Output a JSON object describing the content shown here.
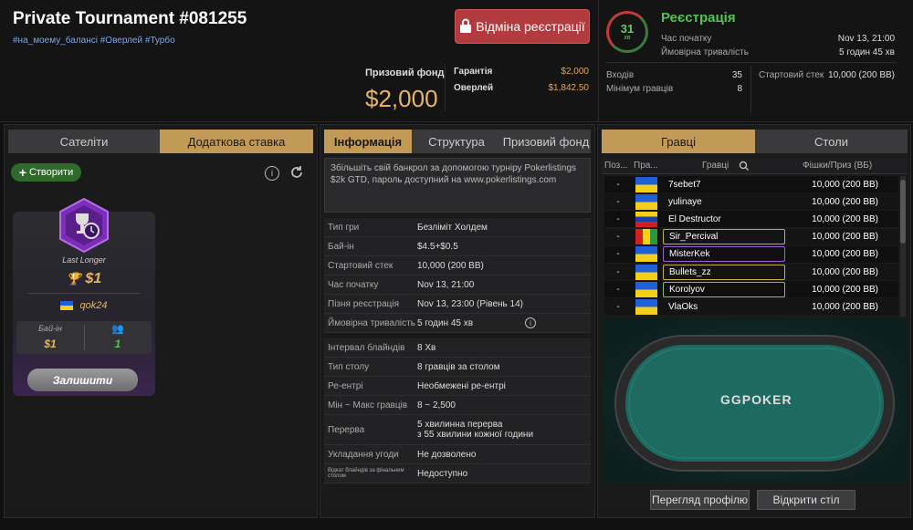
{
  "header": {
    "title": "Private Tournament #081255",
    "tags": "#на_моему_балансі #Оверлей #Турбо",
    "cancel_button": "Відміна реєстрації",
    "prize_fund_label": "Призовий фонд",
    "prize_fund_value": "$2,000",
    "guarantee_label": "Гарантія",
    "guarantee_value": "$2,000",
    "overlay_label": "Оверлей",
    "overlay_value": "$1,842.50",
    "timer_value": "31",
    "timer_unit": "хв",
    "reg_status": "Реєстрація",
    "start_time_label": "Час початку",
    "start_time_value": "Nov 13, 21:00",
    "duration_label": "Ймовірна тривалість",
    "duration_value": "5 годин 45 хв",
    "entries_label": "Входів",
    "entries_value": "35",
    "min_players_label": "Мінімум гравців",
    "min_players_value": "8",
    "start_stack_label": "Стартовий стек",
    "start_stack_value": "10,000 (200 BB)"
  },
  "left": {
    "tabs": [
      "Сателіти",
      "Додаткова ставка"
    ],
    "create_button": "Створити",
    "card": {
      "label": "Last Longer",
      "value": "$1",
      "owner": "qok24",
      "buyin_label": "Бай-ін",
      "buyin_value": "$1",
      "players_value": "1"
    },
    "stay_button": "Залишити"
  },
  "middle": {
    "tabs": [
      "Інформація",
      "Структура",
      "Призовий фонд"
    ],
    "description": "Збільшіть свій банкрол за допомогою турніру Pokerlistings $2k GTD, пароль доступний на www.pokerlistings.com",
    "rows": [
      {
        "k": "Тип гри",
        "v": "Безліміт Холдем"
      },
      {
        "k": "Бай-ін",
        "v": "$4.5+$0.5"
      },
      {
        "k": "Стартовий стек",
        "v": "10,000 (200 BB)"
      },
      {
        "k": "Час початку",
        "v": "Nov 13, 21:00"
      },
      {
        "k": "Пізня реєстрація",
        "v": "Nov 13, 23:00 (Рівень 14)"
      },
      {
        "k": "Ймовірна тривалість",
        "v": "5 годин 45 хв"
      },
      {
        "k": "Інтервал блайндів",
        "v": "8 Хв"
      },
      {
        "k": "Тип столу",
        "v": "8 гравців за столом"
      },
      {
        "k": "Ре-ентрі",
        "v": "Необмежені ре-ентрі"
      },
      {
        "k": "Мін ~ Макс гравців",
        "v": "8 ~ 2,500"
      },
      {
        "k": "Перерва",
        "v": "5 хвилинна перерва\nз 55 хвилини кожної години"
      },
      {
        "k": "Укладання угоди",
        "v": "Не дозволено"
      },
      {
        "k": "Відкат блайндів за фінальним столом",
        "v": "Недоступно"
      }
    ]
  },
  "right": {
    "tabs": [
      "Гравці",
      "Столи"
    ],
    "col_pos": "Поз...",
    "col_flag": "Пра...",
    "col_players": "Гравці",
    "col_chips": "Фішки/Приз (ВБ)",
    "players": [
      {
        "pos": "-",
        "name": "7sebet7",
        "chips": "10,000 (200 BB)",
        "hl": ""
      },
      {
        "pos": "-",
        "name": "yulinaye",
        "chips": "10,000 (200 BB)",
        "hl": ""
      },
      {
        "pos": "-",
        "name": "El Destructor",
        "chips": "10,000 (200 BB)",
        "hl": ""
      },
      {
        "pos": "-",
        "name": "Sir_Percival",
        "chips": "10,000 (200 BB)",
        "hl": "hl"
      },
      {
        "pos": "-",
        "name": "MisterKek",
        "chips": "10,000 (200 BB)",
        "hl": "hlp"
      },
      {
        "pos": "-",
        "name": "Bullets_zz",
        "chips": "10,000 (200 BB)",
        "hl": "hl"
      },
      {
        "pos": "-",
        "name": "Korolyov",
        "chips": "10,000 (200 BB)",
        "hl": "hlg"
      },
      {
        "pos": "-",
        "name": "VlaOks",
        "chips": "10,000 (200 BB)",
        "hl": ""
      }
    ],
    "table_logo": "GGPOKER",
    "view_profile_button": "Перегляд профілю",
    "open_table_button": "Відкрити стіл"
  }
}
